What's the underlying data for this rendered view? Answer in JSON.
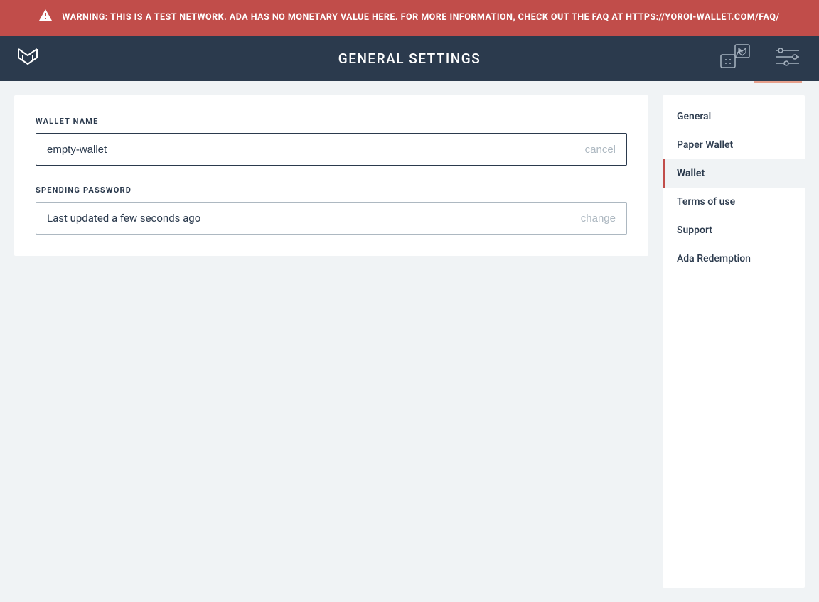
{
  "warning": {
    "prefix": "WARNING: THIS IS A TEST NETWORK. ADA HAS NO MONETARY VALUE HERE. FOR MORE INFORMATION, CHECK OUT THE FAQ AT ",
    "link_text": "HTTPS://YOROI-WALLET.COM/FAQ/"
  },
  "header": {
    "title": "GENERAL SETTINGS"
  },
  "main": {
    "wallet_name": {
      "label": "WALLET NAME",
      "value": "empty-wallet",
      "action": "cancel"
    },
    "spending_password": {
      "label": "SPENDING PASSWORD",
      "status": "Last updated a few seconds ago",
      "action": "change"
    }
  },
  "sidebar": {
    "items": [
      {
        "label": "General",
        "active": false
      },
      {
        "label": "Paper Wallet",
        "active": false
      },
      {
        "label": "Wallet",
        "active": true
      },
      {
        "label": "Terms of use",
        "active": false
      },
      {
        "label": "Support",
        "active": false
      },
      {
        "label": "Ada Redemption",
        "active": false
      }
    ]
  }
}
